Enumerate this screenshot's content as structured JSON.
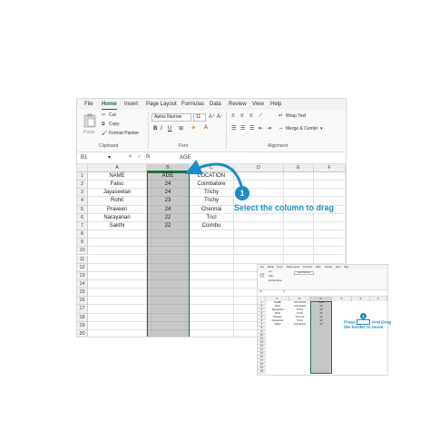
{
  "main": {
    "tabs": [
      "File",
      "Home",
      "Insert",
      "Page Layout",
      "Formulas",
      "Data",
      "Review",
      "View",
      "Help"
    ],
    "active_tab": "Home",
    "clipboard": {
      "paste": "Paste",
      "cut": "Cut",
      "copy": "Copy",
      "format_painter": "Format Painter",
      "group": "Clipboard"
    },
    "font": {
      "name": "Aptos Narrow",
      "size": "11",
      "group": "Font",
      "bold": "B",
      "italic": "I",
      "underline": "U"
    },
    "alignment": {
      "wrap_text": "Wrap Text",
      "merge_center": "Merge & Center",
      "group": "Alignment"
    },
    "name_box": "B1",
    "formula_value": "AGE",
    "columns": [
      "A",
      "B",
      "C",
      "D",
      "E",
      "F"
    ],
    "rows": [
      "1",
      "2",
      "3",
      "4",
      "5",
      "6",
      "7",
      "8",
      "9",
      "10",
      "11",
      "12",
      "13",
      "14",
      "15",
      "16",
      "17",
      "18",
      "19",
      "20"
    ],
    "data": [
      [
        "NAME",
        "AGE",
        "LOCATION"
      ],
      [
        "Faisu",
        "24",
        "Coimbatore"
      ],
      [
        "Jayaseelan",
        "24",
        "Trichy"
      ],
      [
        "Rohit",
        "23",
        "Trichy"
      ],
      [
        "Praveen",
        "24",
        "Chennai"
      ],
      [
        "Narayanan",
        "22",
        "Tricl"
      ],
      [
        "Sakthi",
        "22",
        "Coimbu"
      ]
    ],
    "callout": {
      "number": "1",
      "text": "Select the column to drag"
    }
  },
  "inset": {
    "tabs": [
      "File",
      "Home",
      "Insert",
      "Page Layout",
      "Formulas",
      "Data",
      "Review",
      "View",
      "Help"
    ],
    "clipboard": {
      "cut": "Cut",
      "copy": "Copy",
      "format_painter": "Format Painter"
    },
    "font_name": "Aptos Narrow",
    "name_box": "C1",
    "columns": [
      "A",
      "B",
      "C",
      "D",
      "E",
      "F"
    ],
    "rows": [
      "1",
      "2",
      "3",
      "4",
      "5",
      "6",
      "7",
      "8",
      "9",
      "10",
      "11",
      "12",
      "13",
      "14",
      "15",
      "16",
      "17",
      "18",
      "19",
      "20"
    ],
    "data": [
      [
        "NAME",
        "LOCATION",
        "AGE"
      ],
      [
        "Faisu",
        "Coimbatore",
        "24"
      ],
      [
        "Jayaseelan",
        "Trichy",
        "24"
      ],
      [
        "Rohit",
        "Trichy",
        "23"
      ],
      [
        "Praveen",
        "Chennai",
        "24"
      ],
      [
        "Narayanan",
        "Trichy",
        "22"
      ],
      [
        "Sakthi",
        "Coimbatore",
        "22"
      ]
    ],
    "callout": {
      "number": "1",
      "text_line1": "Press",
      "text_line2": "And Drag",
      "text_line3": "the border to move"
    }
  },
  "colors": {
    "accent": "#1b8dc7",
    "excel_green": "#1e7145",
    "selection": "#c6c6c6"
  }
}
